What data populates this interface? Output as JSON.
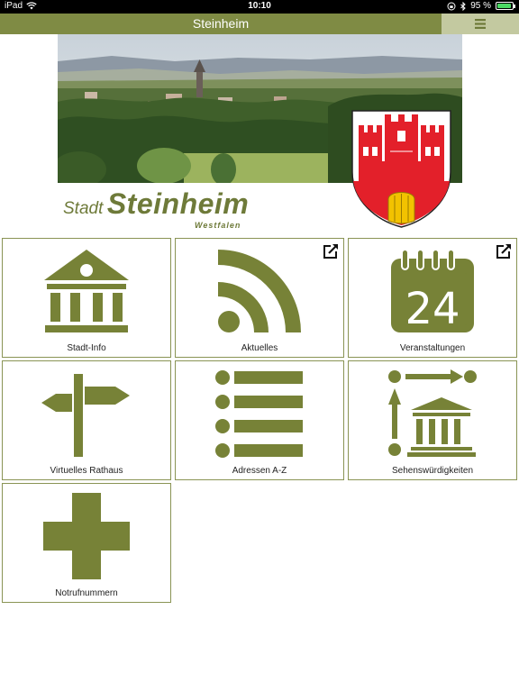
{
  "status": {
    "device": "iPad",
    "time": "10:10",
    "battery": "95 %",
    "battery_level": 0.95
  },
  "nav": {
    "title": "Steinheim",
    "menu_icon": "hamburger-menu-icon"
  },
  "header": {
    "brand_prefix": "Stadt",
    "brand_name": "Steinheim",
    "brand_region": "Westfalen"
  },
  "colors": {
    "accent": "#7f8b44",
    "menu_bg": "#c3c9a0",
    "icon": "#778237",
    "crest_red": "#e3202a",
    "crest_gold": "#f2c200"
  },
  "tiles": [
    {
      "label": "Stadt-Info",
      "icon": "city-hall-icon",
      "external": false
    },
    {
      "label": "Aktuelles",
      "icon": "rss-feed-icon",
      "external": true
    },
    {
      "label": "Veranstaltungen",
      "icon": "calendar-icon",
      "calendar_day": "24",
      "external": true
    },
    {
      "label": "Virtuelles Rathaus",
      "icon": "signpost-icon",
      "external": false
    },
    {
      "label": "Adressen A-Z",
      "icon": "list-icon",
      "external": false
    },
    {
      "label": "Sehenswürdigkeiten",
      "icon": "sightseeing-route-icon",
      "external": false
    },
    {
      "label": "Notrufnummern",
      "icon": "medical-cross-icon",
      "external": false
    }
  ]
}
